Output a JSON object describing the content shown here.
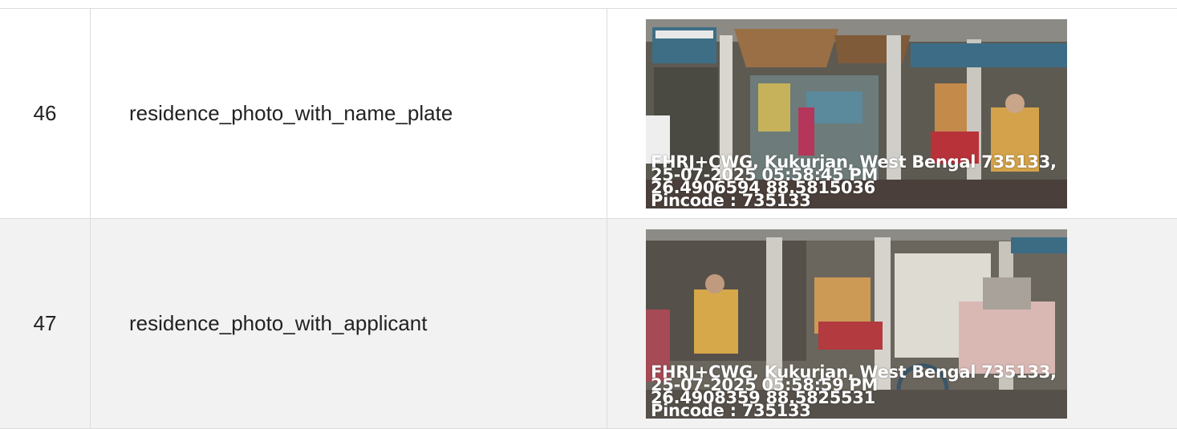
{
  "rows": [
    {
      "number": "46",
      "field": "residence_photo_with_name_plate",
      "photo": {
        "icon": "storefront-photo",
        "overlay": {
          "line1": "FHRJ+CWG, Kukurjan, West Bengal 735133,",
          "line2": "25-07-2025 05:58:45 PM",
          "line3": "26.4906594 88.5815036",
          "line4": "Pincode : 735133"
        }
      }
    },
    {
      "number": "47",
      "field": "residence_photo_with_applicant",
      "photo": {
        "icon": "storefront-photo",
        "overlay": {
          "line1": "FHRJ+CWG, Kukurjan, West Bengal 735133,",
          "line2": "25-07-2025 05:58:59 PM",
          "line3": "26.4908359 88.5825531",
          "line4": "Pincode : 735133"
        }
      }
    }
  ],
  "colors": {
    "border": "#dcdcdc",
    "alt_row": "#f2f2f2",
    "text": "#222222"
  }
}
